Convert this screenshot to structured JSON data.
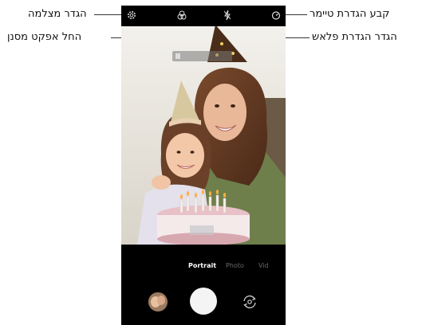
{
  "callouts": {
    "camera_settings": "הגדר מצלמה",
    "filter_effect": "החל אפקט מסנן",
    "timer": "קבע הגדרת טיימר",
    "flash": "הגדר הגדרת פלאש"
  },
  "camera": {
    "modes": [
      "Portrait",
      "Photo",
      "Vid"
    ],
    "active_mode_index": 0
  },
  "icons": {
    "settings": "gear-icon",
    "filter": "filter-icon",
    "flash": "flash-off-icon",
    "timer": "timer-icon",
    "shutter": "shutter-button",
    "switch_camera": "switch-camera-icon",
    "gallery": "gallery-thumbnail"
  }
}
